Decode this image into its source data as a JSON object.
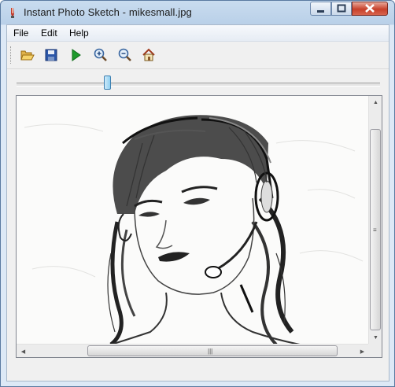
{
  "window": {
    "title": "Instant Photo Sketch - mikesmall.jpg"
  },
  "menu": [
    "File",
    "Edit",
    "Help"
  ],
  "toolbar": {
    "buttons": [
      {
        "name": "open-button",
        "icon": "folder-open-icon"
      },
      {
        "name": "save-button",
        "icon": "floppy-disk-icon"
      },
      {
        "name": "run-button",
        "icon": "play-icon"
      },
      {
        "name": "zoom-in-button",
        "icon": "zoom-in-icon"
      },
      {
        "name": "zoom-out-button",
        "icon": "zoom-out-icon"
      },
      {
        "name": "home-button",
        "icon": "home-icon"
      }
    ]
  },
  "slider": {
    "value_fraction": 0.25
  },
  "image_view": {
    "description_icon": "sketch-portrait-image"
  },
  "scroll": {
    "vertical_thumb_grip": "≡",
    "horizontal_thumb_grip": "|||"
  },
  "colors": {
    "title_gradient_top": "#c9dcef",
    "close_button": "#c7402b",
    "slider_thumb": "#8fd0f2"
  }
}
